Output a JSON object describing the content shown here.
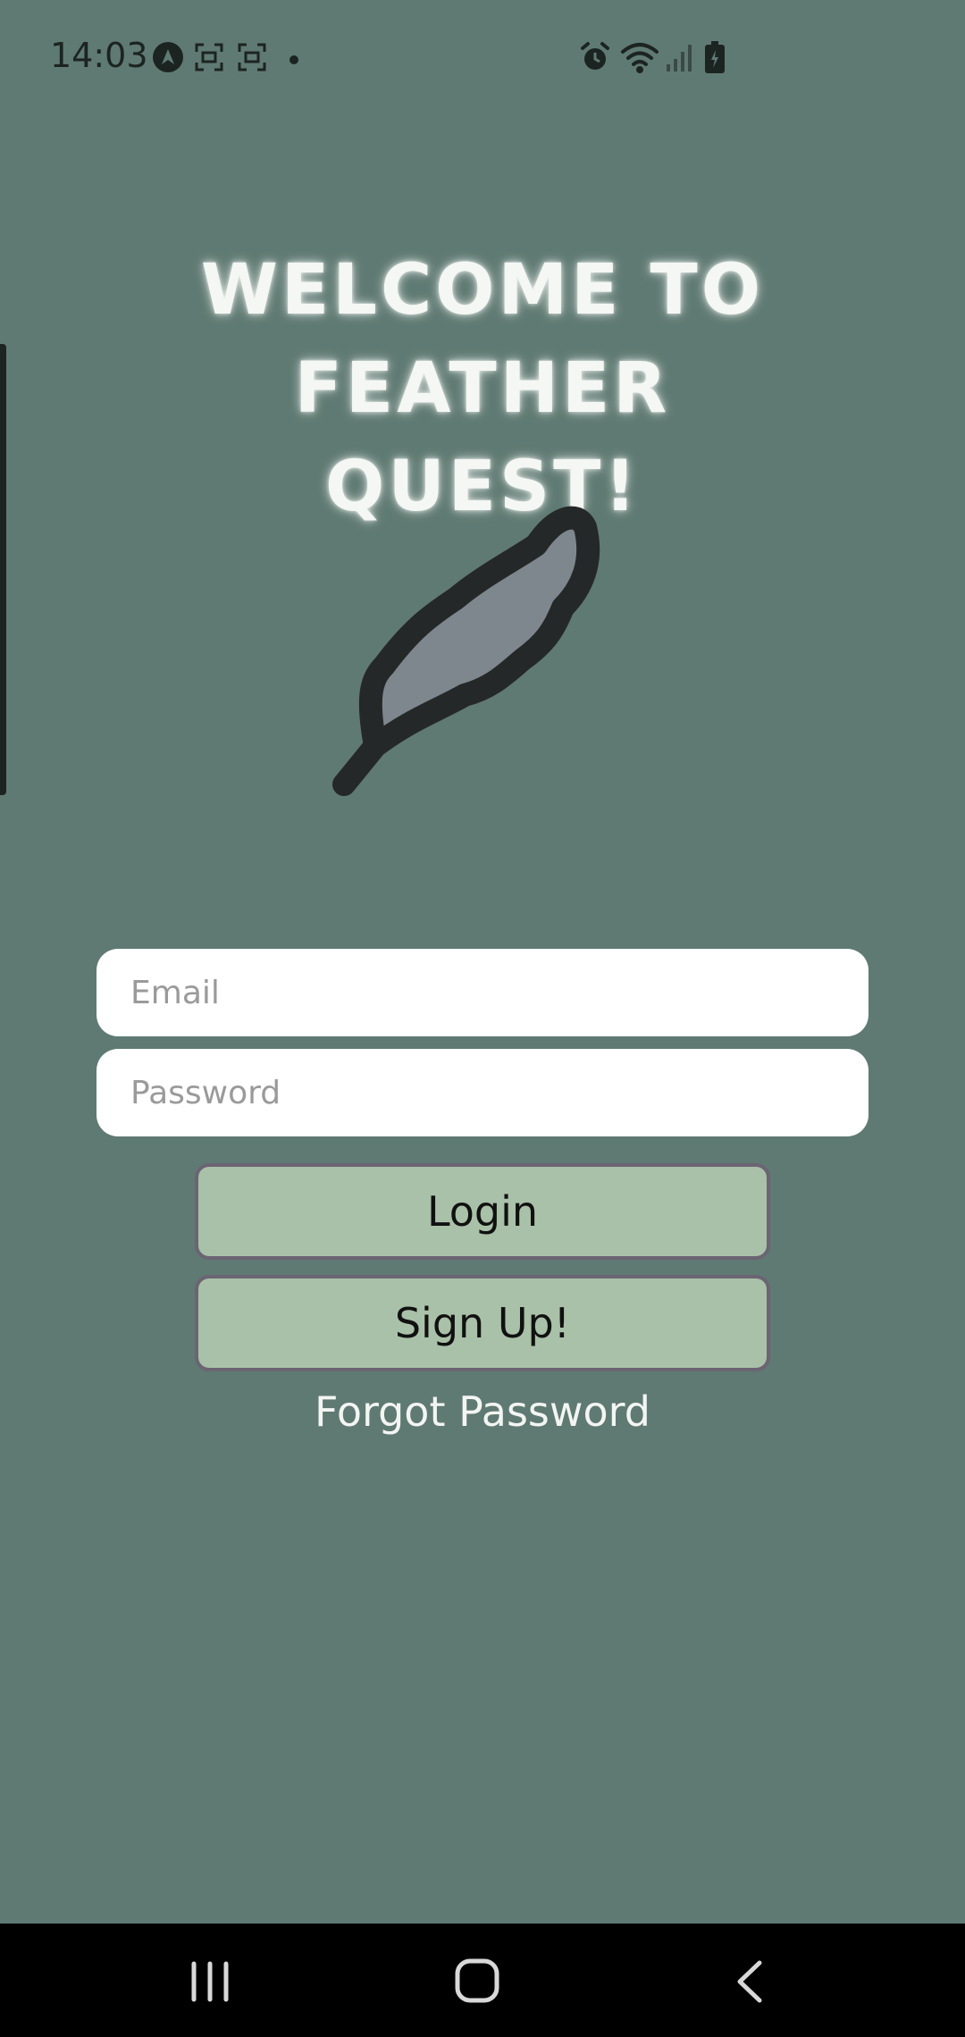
{
  "status_bar": {
    "time": "14:03",
    "icons": [
      "navigation-app-icon",
      "screenshot-icon",
      "screen-record-icon",
      "dot-icon",
      "alarm-icon",
      "wifi-icon",
      "signal-icon",
      "battery-icon"
    ]
  },
  "title": {
    "line1": "WELCOME TO FEATHER",
    "line2": "QUEST!"
  },
  "logo": "feather-icon",
  "form": {
    "email_placeholder": "Email",
    "password_placeholder": "Password",
    "login_label": "Login",
    "signup_label": "Sign Up!",
    "forgot_label": "Forgot Password"
  },
  "nav": {
    "icons": [
      "recent-apps-icon",
      "home-icon",
      "back-icon"
    ]
  },
  "colors": {
    "background": "#5f7a72",
    "button": "#a9c1a8",
    "button_border": "#6b6473",
    "feather_fill": "#7f878e",
    "feather_outline": "#252828"
  }
}
